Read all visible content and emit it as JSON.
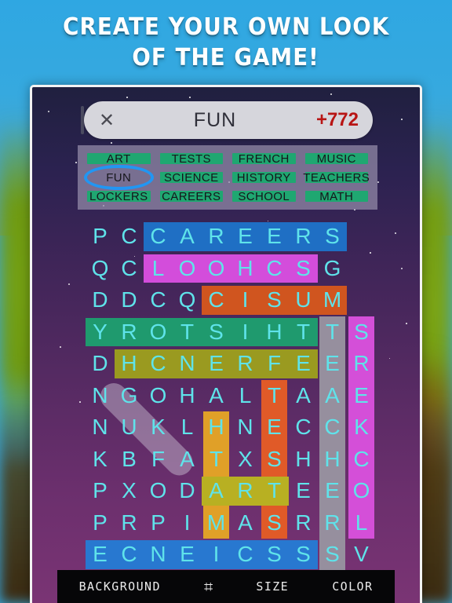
{
  "banner": {
    "line1": "CREATE YOUR OWN LOOK",
    "line2": "OF THE GAME!"
  },
  "topbar": {
    "close_icon": "✕",
    "title": "FUN",
    "score": "+772"
  },
  "wordlist": {
    "rows": [
      [
        {
          "label": "ART",
          "found": true,
          "selected": false
        },
        {
          "label": "TESTS",
          "found": true,
          "selected": false
        },
        {
          "label": "FRENCH",
          "found": true,
          "selected": false
        },
        {
          "label": "MUSIC",
          "found": true,
          "selected": false
        }
      ],
      [
        {
          "label": "FUN",
          "found": false,
          "selected": true
        },
        {
          "label": "SCIENCE",
          "found": true,
          "selected": false
        },
        {
          "label": "HISTORY",
          "found": true,
          "selected": false
        },
        {
          "label": "TEACHERS",
          "found": true,
          "selected": false
        }
      ],
      [
        {
          "label": "LOCKERS",
          "found": true,
          "selected": false
        },
        {
          "label": "CAREERS",
          "found": true,
          "selected": false
        },
        {
          "label": "SCHOOL",
          "found": true,
          "selected": false
        },
        {
          "label": "MATH",
          "found": true,
          "selected": false
        }
      ]
    ],
    "selection_color": "#2196f3",
    "found_color": "#1fa771"
  },
  "grid": {
    "columns": 10,
    "rows": 11,
    "letter_color": "#5fe3ea",
    "letters": [
      [
        "P",
        "C",
        "C",
        "A",
        "R",
        "E",
        "E",
        "R",
        "S",
        ""
      ],
      [
        "Q",
        "C",
        "L",
        "O",
        "O",
        "H",
        "C",
        "S",
        "G",
        ""
      ],
      [
        "D",
        "D",
        "C",
        "Q",
        "C",
        "I",
        "S",
        "U",
        "M",
        ""
      ],
      [
        "Y",
        "R",
        "O",
        "T",
        "S",
        "I",
        "H",
        "T",
        "T",
        "S"
      ],
      [
        "D",
        "H",
        "C",
        "N",
        "E",
        "R",
        "F",
        "E",
        "E",
        "R"
      ],
      [
        "N",
        "G",
        "O",
        "H",
        "A",
        "L",
        "T",
        "A",
        "A",
        "E"
      ],
      [
        "N",
        "U",
        "K",
        "L",
        "H",
        "N",
        "E",
        "C",
        "C",
        "K"
      ],
      [
        "K",
        "B",
        "F",
        "A",
        "T",
        "X",
        "S",
        "H",
        "H",
        "C"
      ],
      [
        "P",
        "X",
        "O",
        "D",
        "A",
        "R",
        "T",
        "E",
        "E",
        "O"
      ],
      [
        "P",
        "R",
        "P",
        "I",
        "M",
        "A",
        "S",
        "R",
        "R",
        "L"
      ],
      [
        "E",
        "C",
        "N",
        "E",
        "I",
        "C",
        "S",
        "S",
        "S",
        "V"
      ]
    ],
    "highlights": [
      {
        "word": "CAREERS",
        "color": "#1f6fc4",
        "row": 0,
        "start": 2,
        "end": 8,
        "orientation": "horizontal"
      },
      {
        "word": "SCHOOL",
        "color": "#d34ddb",
        "row": 1,
        "start": 2,
        "end": 7,
        "orientation": "horizontal"
      },
      {
        "word": "MUSIC",
        "color": "#d0551f",
        "row": 2,
        "start": 4,
        "end": 8,
        "orientation": "horizontal"
      },
      {
        "word": "HISTORY",
        "color": "#1f9a6e",
        "row": 3,
        "start": 0,
        "end": 7,
        "orientation": "horizontal"
      },
      {
        "word": "FRENCH",
        "color": "#9a9a20",
        "row": 4,
        "start": 1,
        "end": 7,
        "orientation": "horizontal"
      },
      {
        "word": "SCIENCE",
        "color": "#2878d0",
        "row": 10,
        "start": 0,
        "end": 7,
        "orientation": "horizontal"
      },
      {
        "word": "TEACHERS",
        "color": "#968f9e",
        "col": 8,
        "start": 3,
        "end": 10,
        "orientation": "vertical"
      },
      {
        "word": "LOCKERS",
        "color": "#d44fd8",
        "col": 9,
        "start": 3,
        "end": 9,
        "orientation": "vertical"
      },
      {
        "word": "TESTS",
        "color": "#e05a28",
        "col": 6,
        "start": 5,
        "end": 9,
        "orientation": "vertical"
      },
      {
        "word": "MATH",
        "color": "#e0a028",
        "col": 4,
        "start": 6,
        "end": 9,
        "orientation": "vertical"
      },
      {
        "word": "ART",
        "color": "#b8b022",
        "row": 8,
        "start": 4,
        "end": 6,
        "orientation": "horizontal"
      }
    ]
  },
  "toolbar": {
    "items": [
      {
        "label": "BACKGROUND",
        "icon": null
      },
      {
        "label": null,
        "icon": "⌗"
      },
      {
        "label": "SIZE",
        "icon": null
      },
      {
        "label": "COLOR",
        "icon": null
      }
    ]
  }
}
